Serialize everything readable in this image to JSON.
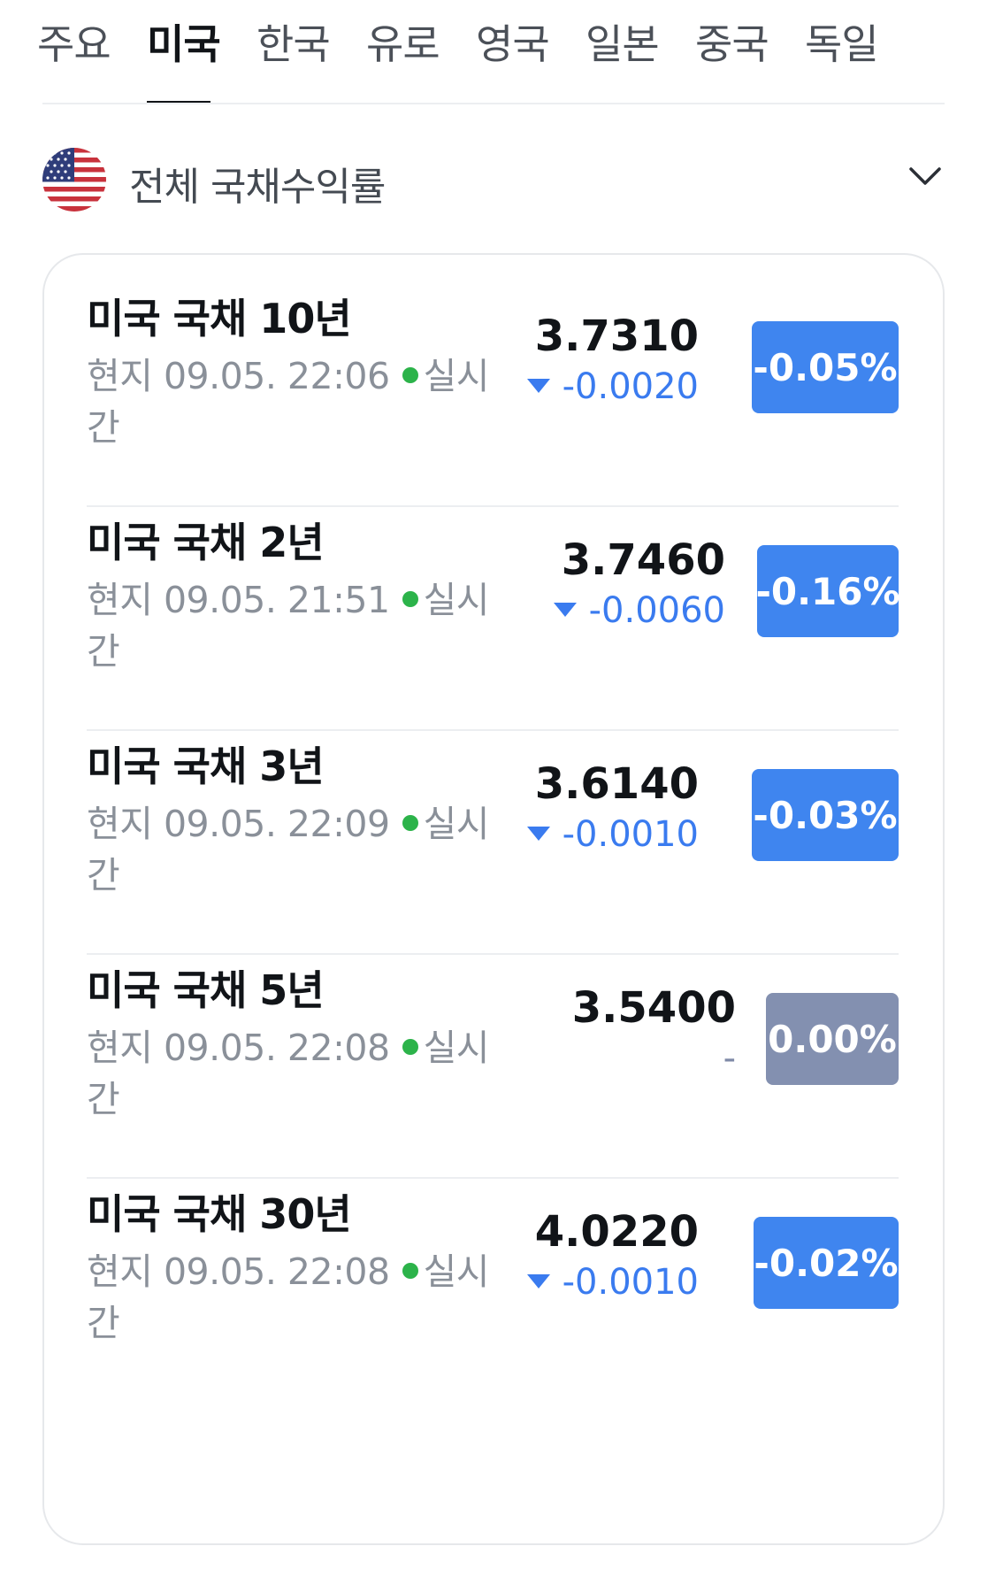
{
  "tabs": [
    "주요",
    "미국",
    "한국",
    "유로",
    "영국",
    "일본",
    "중국",
    "독일"
  ],
  "active_tab_index": 1,
  "header": {
    "flag_icon": "us-flag-icon",
    "title": "전체 국채수익률",
    "chevron_icon": "chevron-down-icon"
  },
  "colors": {
    "accent_blue": "#3f85ef",
    "neutral_badge": "#8390b0",
    "live_green": "#2cb34a"
  },
  "bonds": [
    {
      "name": "미국 국채 10년",
      "meta": "현지 09.05. 22:06",
      "live_label": "실시간",
      "price": "3.7310",
      "change": "-0.0020",
      "direction": "down",
      "percent": "-0.05%"
    },
    {
      "name": "미국 국채 2년",
      "meta": "현지 09.05. 21:51",
      "live_label": "실시간",
      "price": "3.7460",
      "change": "-0.0060",
      "direction": "down",
      "percent": "-0.16%"
    },
    {
      "name": "미국 국채 3년",
      "meta": "현지 09.05. 22:09",
      "live_label": "실시간",
      "price": "3.6140",
      "change": "-0.0010",
      "direction": "down",
      "percent": "-0.03%"
    },
    {
      "name": "미국 국채 5년",
      "meta": "현지 09.05. 22:08",
      "live_label": "실시간",
      "price": "3.5400",
      "change": "-",
      "direction": "flat",
      "percent": "0.00%"
    },
    {
      "name": "미국 국채 30년",
      "meta": "현지 09.05. 22:08",
      "live_label": "실시간",
      "price": "4.0220",
      "change": "-0.0010",
      "direction": "down",
      "percent": "-0.02%"
    }
  ]
}
